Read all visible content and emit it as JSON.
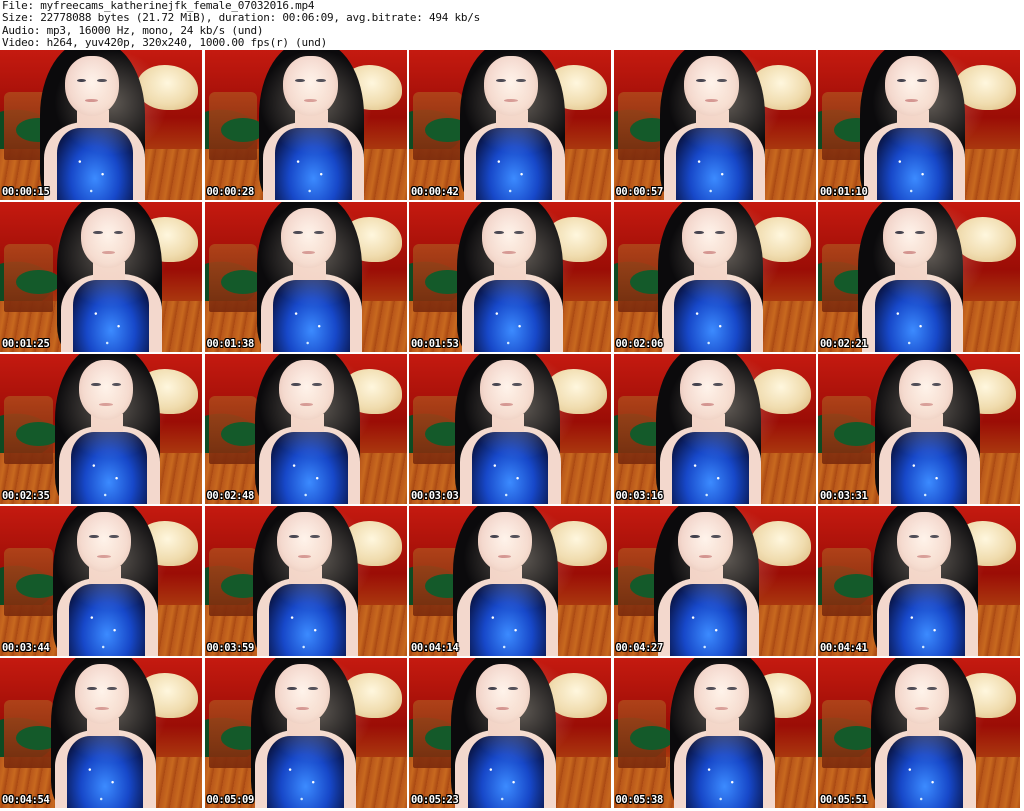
{
  "header": {
    "file_line": "File: myfreecams_katherinejfk_female_07032016.mp4",
    "size_line": "Size: 22778088 bytes (21.72 MiB), duration: 00:06:09, avg.bitrate: 494 kb/s",
    "audio_line": "Audio: mp3, 16000 Hz, mono, 24 kb/s (und)",
    "video_line": "Video: h264, yuv420p, 320x240, 1000.00 fps(r) (und)"
  },
  "thumbnails": [
    {
      "timestamp": "00:00:15"
    },
    {
      "timestamp": "00:00:28"
    },
    {
      "timestamp": "00:00:42"
    },
    {
      "timestamp": "00:00:57"
    },
    {
      "timestamp": "00:01:10"
    },
    {
      "timestamp": "00:01:25"
    },
    {
      "timestamp": "00:01:38"
    },
    {
      "timestamp": "00:01:53"
    },
    {
      "timestamp": "00:02:06"
    },
    {
      "timestamp": "00:02:21"
    },
    {
      "timestamp": "00:02:35"
    },
    {
      "timestamp": "00:02:48"
    },
    {
      "timestamp": "00:03:03"
    },
    {
      "timestamp": "00:03:16"
    },
    {
      "timestamp": "00:03:31"
    },
    {
      "timestamp": "00:03:44"
    },
    {
      "timestamp": "00:03:59"
    },
    {
      "timestamp": "00:04:14"
    },
    {
      "timestamp": "00:04:27"
    },
    {
      "timestamp": "00:04:41"
    },
    {
      "timestamp": "00:04:54"
    },
    {
      "timestamp": "00:05:09"
    },
    {
      "timestamp": "00:05:23"
    },
    {
      "timestamp": "00:05:38"
    },
    {
      "timestamp": "00:05:51"
    }
  ]
}
